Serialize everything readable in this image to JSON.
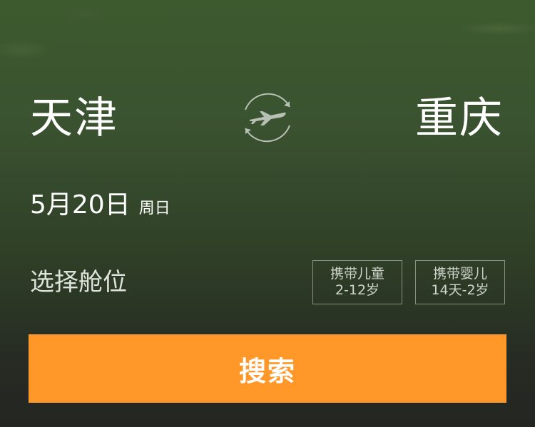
{
  "route": {
    "from_city": "天津",
    "to_city": "重庆",
    "swap_icon": "plane-swap-icon"
  },
  "date": {
    "main": "5月20日",
    "weekday": "周日"
  },
  "cabin": {
    "label": "选择舱位"
  },
  "passengers": {
    "child_line1": "携带儿童",
    "child_line2": "2-12岁",
    "infant_line1": "携带婴儿",
    "infant_line2": "14天-2岁"
  },
  "search_button": {
    "label": "搜索"
  },
  "colors": {
    "accent": "#ff9829",
    "background_top": "#3d5a2e",
    "background_bottom": "#242622"
  }
}
